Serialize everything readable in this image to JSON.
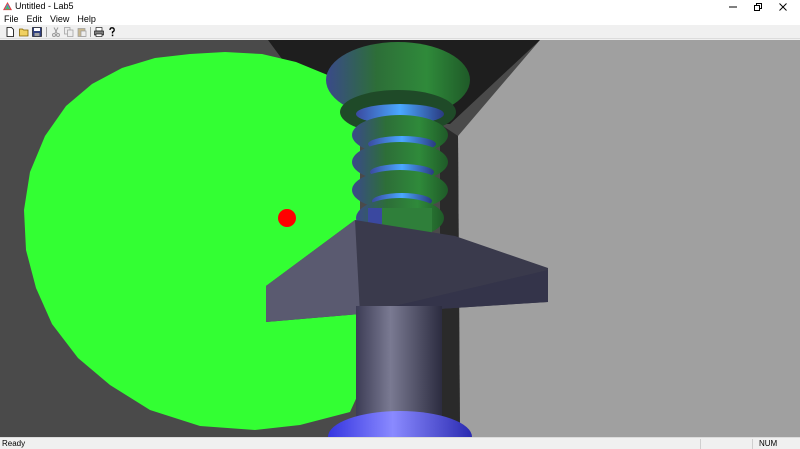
{
  "window": {
    "title": "Untitled - Lab5",
    "minimize_icon": "minimize-icon",
    "maximize_icon": "restore-icon",
    "close_icon": "close-icon"
  },
  "menu": {
    "items": [
      {
        "label": "File"
      },
      {
        "label": "Edit"
      },
      {
        "label": "View"
      },
      {
        "label": "Help"
      }
    ]
  },
  "toolbar": {
    "buttons": [
      {
        "icon": "new-file-icon",
        "enabled": true
      },
      {
        "icon": "open-folder-icon",
        "enabled": true
      },
      {
        "icon": "save-icon",
        "enabled": true
      },
      {
        "icon": "cut-icon",
        "enabled": false
      },
      {
        "icon": "copy-icon",
        "enabled": false
      },
      {
        "icon": "paste-icon",
        "enabled": false
      },
      {
        "icon": "print-icon",
        "enabled": true
      },
      {
        "icon": "help-icon",
        "enabled": true
      }
    ]
  },
  "scene": {
    "background_color": "#4a4a4a",
    "right_wall_color": "#a0a0a0",
    "ceiling_color": "#1e1e1e",
    "disc_color": "#33ff33",
    "marker_color": "#ff0000",
    "spiral_color": "#2f7f3f",
    "spiral_highlight": "#3aa0ff",
    "block_color": "#3c3c50",
    "pillar_color": "#4a4a60",
    "base_color": "#3a3aff"
  },
  "status": {
    "text": "Ready",
    "num": "NUM"
  }
}
